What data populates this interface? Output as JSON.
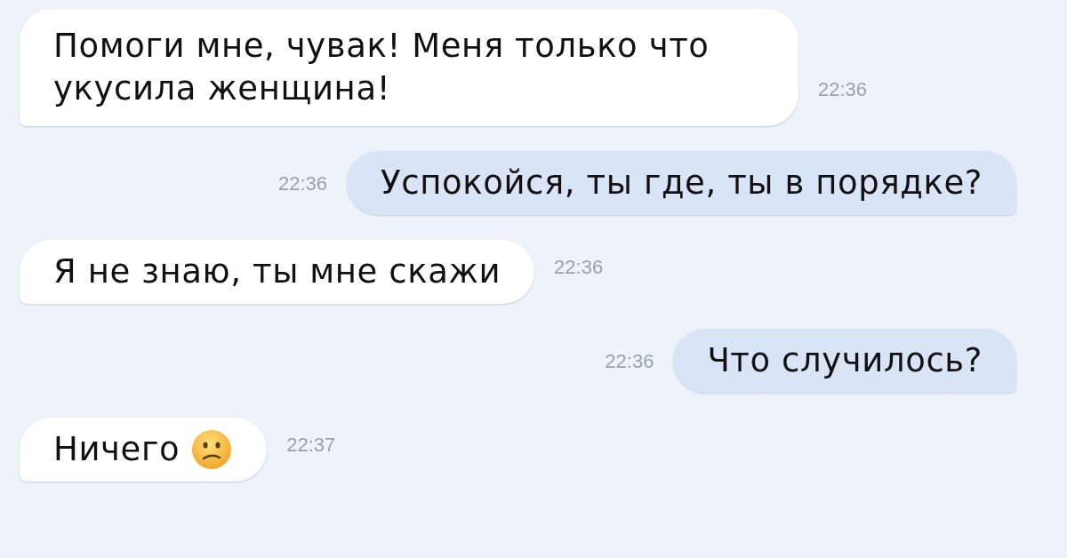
{
  "messages": [
    {
      "kind": "incoming",
      "text": "Помоги мне, чувак! Меня только что укусила женщина!",
      "time": "22:36",
      "trailing_icon": false
    },
    {
      "kind": "outgoing",
      "text": "Успокойся, ты где, ты в порядке?",
      "time": "22:36",
      "trailing_icon": false
    },
    {
      "kind": "incoming",
      "text": "Я не знаю, ты мне скажи",
      "time": "22:36",
      "trailing_icon": false
    },
    {
      "kind": "outgoing",
      "text": "Что случилось?",
      "time": "22:36",
      "trailing_icon": false
    },
    {
      "kind": "incoming",
      "text": "Ничего",
      "time": "22:37",
      "trailing_icon": true
    }
  ]
}
